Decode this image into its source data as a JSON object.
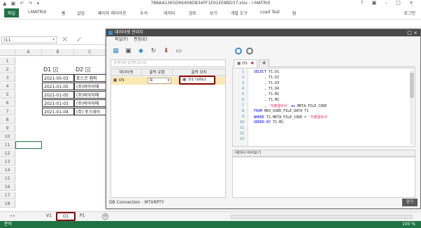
{
  "excel": {
    "title": "788AA1365D96408D834FF1E91EE8BD37.xlsx - I-MATRIX",
    "ribbon_tabs": [
      "파일",
      "I-MATRIX",
      "홈",
      "삽입",
      "페이지 레이아웃",
      "수식",
      "데이터",
      "검토",
      "보기",
      "개발 도구",
      "Load Test",
      "팀"
    ],
    "login": "로그인",
    "window_controls": "? ▣ – □ ×",
    "namebox": "I11",
    "columns": [
      "A",
      "B",
      "C"
    ],
    "rows": [
      "1",
      "2",
      "3",
      "4",
      "5",
      "6",
      "7",
      "8",
      "9",
      "10",
      "11",
      "12",
      "13",
      "14",
      "15",
      "16",
      "17",
      "18"
    ],
    "cells": {
      "d1": "D1",
      "d2": "D2",
      "r3b": "2021-05-03",
      "r3c": "포스코 캠퍼",
      "r4b": "2021-01-05",
      "r4c": "(주)비아이매",
      "r5b": "2021-01-05",
      "r5c": "(주)비아이매",
      "r6b": "2021-01-03",
      "r6c": "(주)비아이매",
      "r7b": "2021-01-04",
      "r7c": "(주) 포스데이"
    },
    "sheets": [
      "V1",
      "D1",
      "P1"
    ],
    "add_sheet": "+",
    "status": "준비",
    "zoom": "100 %"
  },
  "dialog": {
    "title": "데이터셋 관리자",
    "menu": [
      "파일(F)",
      "편집(E)"
    ],
    "search_placeholder": "검색어를 입력하십시오",
    "grid_headers": [
      "데이터셋",
      "출력 유형",
      "출력 위치"
    ],
    "row": {
      "name": "DS",
      "type": "표",
      "location": "'D1'!$B$2"
    },
    "query_tab": "DS",
    "query_tab_close": "✖",
    "query_tab_add": "✚",
    "code_lines": [
      {
        "n": "1",
        "t": "SELECT T1.D1"
      },
      {
        "n": "2",
        "t": "     , T1.D2"
      },
      {
        "n": "3",
        "t": "     , T1.D3"
      },
      {
        "n": "4",
        "t": "     , T1.D4"
      },
      {
        "n": "5",
        "t": "     , T1.M1"
      },
      {
        "n": "6",
        "t": "     , T1.M2"
      },
      {
        "n": "7",
        "t": "     , '지출결의서' as META_FILE_CODE"
      },
      {
        "n": "8",
        "t": "FROM MEX_USER_FILE_DATA T1"
      },
      {
        "n": "9",
        "t": "WHERE T1.META_FILE_CODE = '지출결의서'"
      },
      {
        "n": "10",
        "t": "ORDER BY T1.M2"
      },
      {
        "n": "11",
        "t": ""
      },
      {
        "n": "12",
        "t": ""
      },
      {
        "n": "13",
        "t": ""
      }
    ],
    "preview_label": "데이터 미리보기",
    "connection": "DB Connection : MTXRPTY",
    "close_button": "닫기"
  },
  "colors": {
    "excel_green": "#217346",
    "highlight": "#8b0000",
    "accent": "#3b8ed0",
    "selected_row": "#fce8b2"
  }
}
